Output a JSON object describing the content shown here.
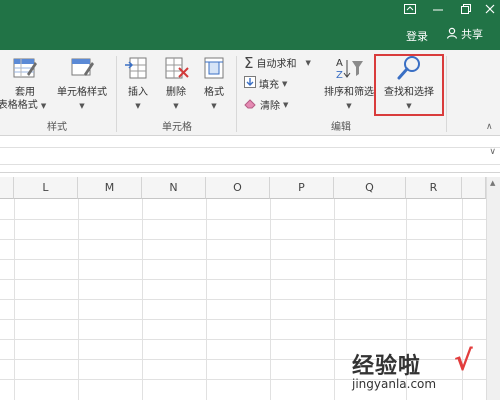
{
  "titlebar": {
    "login_label": "登录",
    "share_label": "共享",
    "accent_color": "#217346"
  },
  "ribbon": {
    "groups": {
      "styles_label": "样式",
      "cells_label": "单元格",
      "editing_label": "编辑"
    },
    "buttons": {
      "format_as_table_line1": "套用",
      "format_as_table_line2": "表格格式",
      "cell_styles": "单元格样式",
      "insert": "插入",
      "delete": "删除",
      "format": "格式",
      "autosum": "自动求和",
      "fill": "填充",
      "clear": "清除",
      "sort_filter": "排序和筛选",
      "find_select": "查找和选择"
    }
  },
  "grid": {
    "columns": [
      "L",
      "M",
      "N",
      "O",
      "P",
      "Q",
      "R"
    ]
  },
  "watermark": {
    "title": "经验啦",
    "url": "jingyanla.com",
    "check_color": "#e23d3d"
  }
}
